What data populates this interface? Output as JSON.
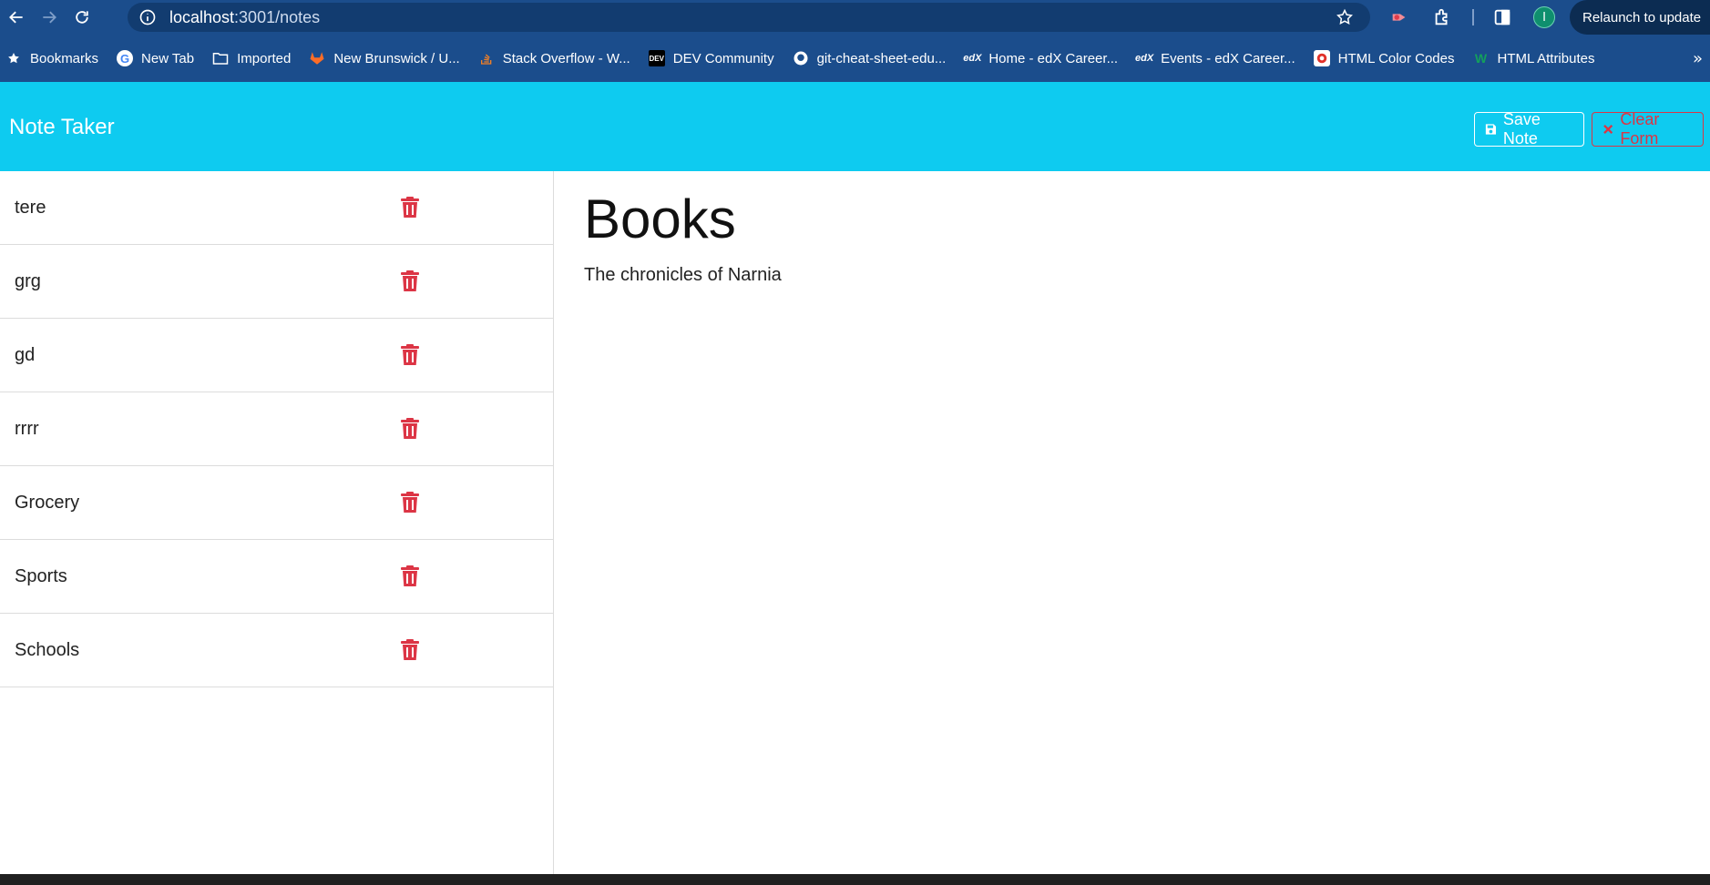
{
  "browser": {
    "url_host": "localhost",
    "url_path": ":3001/notes",
    "relaunch_label": "Relaunch to update",
    "profile_initial": "I"
  },
  "bookmarks": [
    {
      "label": "Bookmarks",
      "icon": "star-icon"
    },
    {
      "label": "New Tab",
      "icon": "google-icon"
    },
    {
      "label": "Imported",
      "icon": "folder-icon"
    },
    {
      "label": "New Brunswick / U...",
      "icon": "gitlab-icon"
    },
    {
      "label": "Stack Overflow - W...",
      "icon": "stackoverflow-icon"
    },
    {
      "label": "DEV Community",
      "icon": "dev-icon"
    },
    {
      "label": "git-cheat-sheet-edu...",
      "icon": "github-icon"
    },
    {
      "label": "Home - edX Career...",
      "icon": "edx-icon"
    },
    {
      "label": "Events - edX Career...",
      "icon": "edx-icon"
    },
    {
      "label": "HTML Color Codes",
      "icon": "colorcodes-icon"
    },
    {
      "label": "HTML Attributes",
      "icon": "w-icon"
    }
  ],
  "app": {
    "title": "Note Taker",
    "save_label": "Save Note",
    "clear_label": "Clear Form",
    "accent": "#0ecbf0",
    "danger": "#dc3545"
  },
  "notes": [
    "tere",
    "grg",
    "gd",
    "rrrr",
    "Grocery",
    "Sports",
    "Schools"
  ],
  "active_note": {
    "title": "Books",
    "text": "The chronicles of Narnia"
  }
}
